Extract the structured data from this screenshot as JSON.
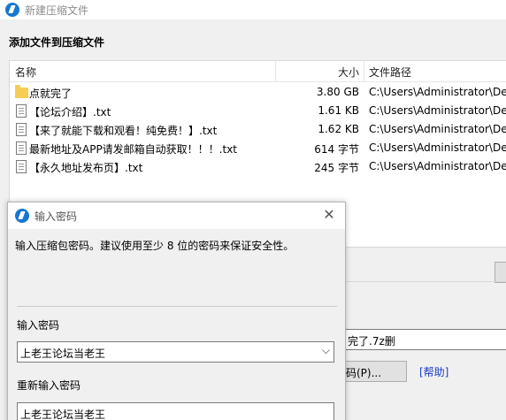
{
  "window": {
    "title": "新建压缩文件",
    "section_title": "添加文件到压缩文件"
  },
  "file_list": {
    "columns": {
      "name": "名称",
      "size": "大小",
      "path": "文件路径"
    },
    "rows": [
      {
        "icon": "folder-icon",
        "name": "点就完了",
        "size": "3.80 GB",
        "path": "C:\\Users\\Administrator\\De"
      },
      {
        "icon": "document-icon",
        "name": "【论坛介绍】.txt",
        "size": "1.61 KB",
        "path": "C:\\Users\\Administrator\\De"
      },
      {
        "icon": "document-icon",
        "name": "【来了就能下载和观看！纯免费！】.txt",
        "size": "1.62 KB",
        "path": "C:\\Users\\Administrator\\De"
      },
      {
        "icon": "document-icon",
        "name": "最新地址及APP请发邮箱自动获取！！！.txt",
        "size": "614 字节",
        "path": "C:\\Users\\Administrator\\De"
      },
      {
        "icon": "document-icon",
        "name": "【永久地址发布页】.txt",
        "size": "245 字节",
        "path": "C:\\Users\\Administrator\\De"
      }
    ]
  },
  "background": {
    "archive_name": "完了.7z删",
    "set_password_label": "码(P)...",
    "help_label": "[帮助]"
  },
  "dialog": {
    "title": "输入密码",
    "close_glyph": "✕",
    "hint": "输入压缩包密码。建议使用至少 8 位的密码来保证安全性。",
    "enter_label": "输入密码",
    "enter_value": "上老王论坛当老王",
    "dropdown_glyph": "⌵",
    "reenter_label": "重新输入密码",
    "reenter_value": "上老王论坛当老王"
  }
}
